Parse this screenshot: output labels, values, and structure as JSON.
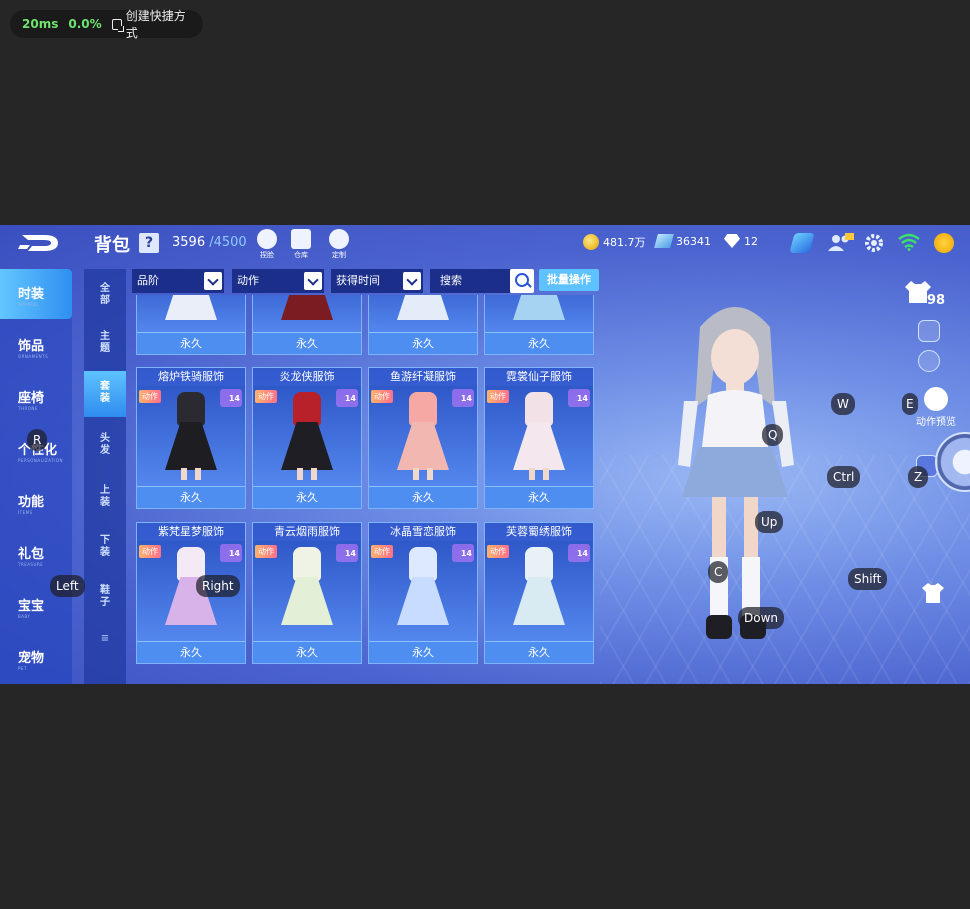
{
  "overlay": {
    "ping": "20ms",
    "loss": "0.0%",
    "shortcut_label": "创建快捷方式"
  },
  "header": {
    "title": "背包",
    "help": "?",
    "capacity_used": "3596",
    "capacity_max": "/4500",
    "icons": [
      {
        "label": "捏脸",
        "icon": "face-icon"
      },
      {
        "label": "仓库",
        "icon": "warehouse-icon"
      },
      {
        "label": "定制",
        "icon": "custom-icon"
      }
    ],
    "currencies": [
      {
        "icon": "coin-icon",
        "value": "481.7万"
      },
      {
        "icon": "coupon-icon",
        "value": "36341"
      },
      {
        "icon": "diamond-icon",
        "value": "12"
      }
    ]
  },
  "left_nav": [
    {
      "label": "时装",
      "en": "APPAREL",
      "active": true
    },
    {
      "label": "饰品",
      "en": "ORNAMENTS",
      "active": false
    },
    {
      "label": "座椅",
      "en": "THRONE",
      "active": false
    },
    {
      "label": "个性化",
      "en": "PERSONALIZATION",
      "active": false
    },
    {
      "label": "功能",
      "en": "ITEMS",
      "active": false
    },
    {
      "label": "礼包",
      "en": "TREASURE",
      "active": false
    },
    {
      "label": "宝宝",
      "en": "BABY",
      "active": false
    },
    {
      "label": "宠物",
      "en": "PET",
      "active": false
    }
  ],
  "sub_nav": [
    {
      "label": "全部",
      "active": false
    },
    {
      "label": "主题",
      "active": false
    },
    {
      "label": "套装",
      "active": true
    },
    {
      "label": "头发",
      "active": false
    },
    {
      "label": "上装",
      "active": false
    },
    {
      "label": "下装",
      "active": false
    },
    {
      "label": "鞋子",
      "active": false
    }
  ],
  "filters": {
    "grade": "品阶",
    "action": "动作",
    "time": "获得时间",
    "search_placeholder": "搜索",
    "batch": "批量操作"
  },
  "items_top_row": [
    {
      "status": "永久"
    },
    {
      "status": "永久"
    },
    {
      "status": "永久"
    },
    {
      "status": "永久"
    }
  ],
  "items": [
    {
      "name": "熔炉铁骑服饰",
      "badge": "动作",
      "level": "14",
      "status": "永久",
      "torso": "#2a2a30",
      "skirt": "#1d1d22"
    },
    {
      "name": "炎龙侠服饰",
      "badge": "动作",
      "level": "14",
      "status": "永久",
      "torso": "#b8202a",
      "skirt": "#1e1e24"
    },
    {
      "name": "鱼游纤凝服饰",
      "badge": "动作",
      "level": "14",
      "status": "永久",
      "torso": "#f6a9a4",
      "skirt": "#f3b7b1"
    },
    {
      "name": "霓裳仙子服饰",
      "badge": "动作",
      "level": "14",
      "status": "永久",
      "torso": "#f2e2e8",
      "skirt": "#f4e8ee"
    },
    {
      "name": "紫梵星梦服饰",
      "badge": "动作",
      "level": "14",
      "status": "永久",
      "torso": "#f3eaf6",
      "skirt": "#d7b3ea"
    },
    {
      "name": "青云烟雨服饰",
      "badge": "动作",
      "level": "14",
      "status": "永久",
      "torso": "#eef3e6",
      "skirt": "#e3efd6"
    },
    {
      "name": "冰晶雪恋服饰",
      "badge": "动作",
      "level": "14",
      "status": "永久",
      "torso": "#dce9ff",
      "skirt": "#c8dcff"
    },
    {
      "name": "芙蓉蜀绣服饰",
      "badge": "动作",
      "level": "14",
      "status": "永久",
      "torso": "#e7f1f6",
      "skirt": "#d9ebf2"
    }
  ],
  "right": {
    "level": "98",
    "action_preview": "动作预览"
  },
  "controls": [
    {
      "key": "W"
    },
    {
      "key": "E"
    },
    {
      "key": "R"
    },
    {
      "key": "Q"
    },
    {
      "key": "Ctrl"
    },
    {
      "key": "Z"
    },
    {
      "key": "Up"
    },
    {
      "key": "Left"
    },
    {
      "key": "Right"
    },
    {
      "key": "C"
    },
    {
      "key": "Shift"
    },
    {
      "key": "Down"
    }
  ]
}
